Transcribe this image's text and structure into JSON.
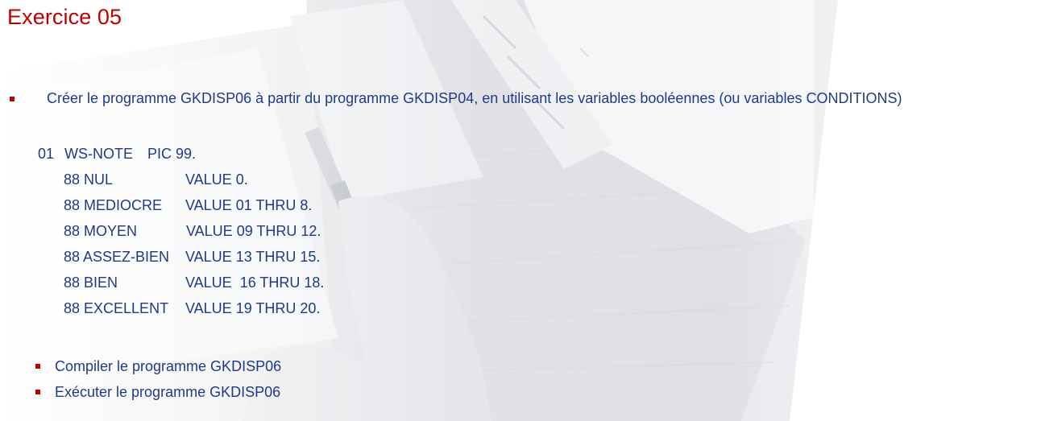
{
  "slide": {
    "title": "Exercice 05",
    "main_bullet": "Créer le programme GKDISP06 à partir du programme GKDISP04, en utilisant les variables booléennes (ou variables CONDITIONS)",
    "code": {
      "declaration": {
        "level": "01",
        "name": "WS-NOTE",
        "pic": "PIC 99."
      },
      "conditions": [
        {
          "level_name": "88 NUL",
          "value": "VALUE 0."
        },
        {
          "level_name": "88 MEDIOCRE",
          "value": "VALUE 01 THRU 8."
        },
        {
          "level_name": "88 MOYEN",
          "value": "VALUE 09 THRU 12."
        },
        {
          "level_name": "88 ASSEZ-BIEN",
          "value": "VALUE 13 THRU 15."
        },
        {
          "level_name": "88 BIEN",
          "value": "VALUE  16 THRU 18."
        },
        {
          "level_name": "88 EXCELLENT",
          "value": "VALUE 19 THRU 20."
        }
      ]
    },
    "sub_bullets": [
      "Compiler le programme GKDISP06",
      "Exécuter le programme GKDISP06"
    ]
  },
  "colors": {
    "title": "#c00000",
    "body_text": "#1f3a8a",
    "bullet": "#c00000"
  }
}
